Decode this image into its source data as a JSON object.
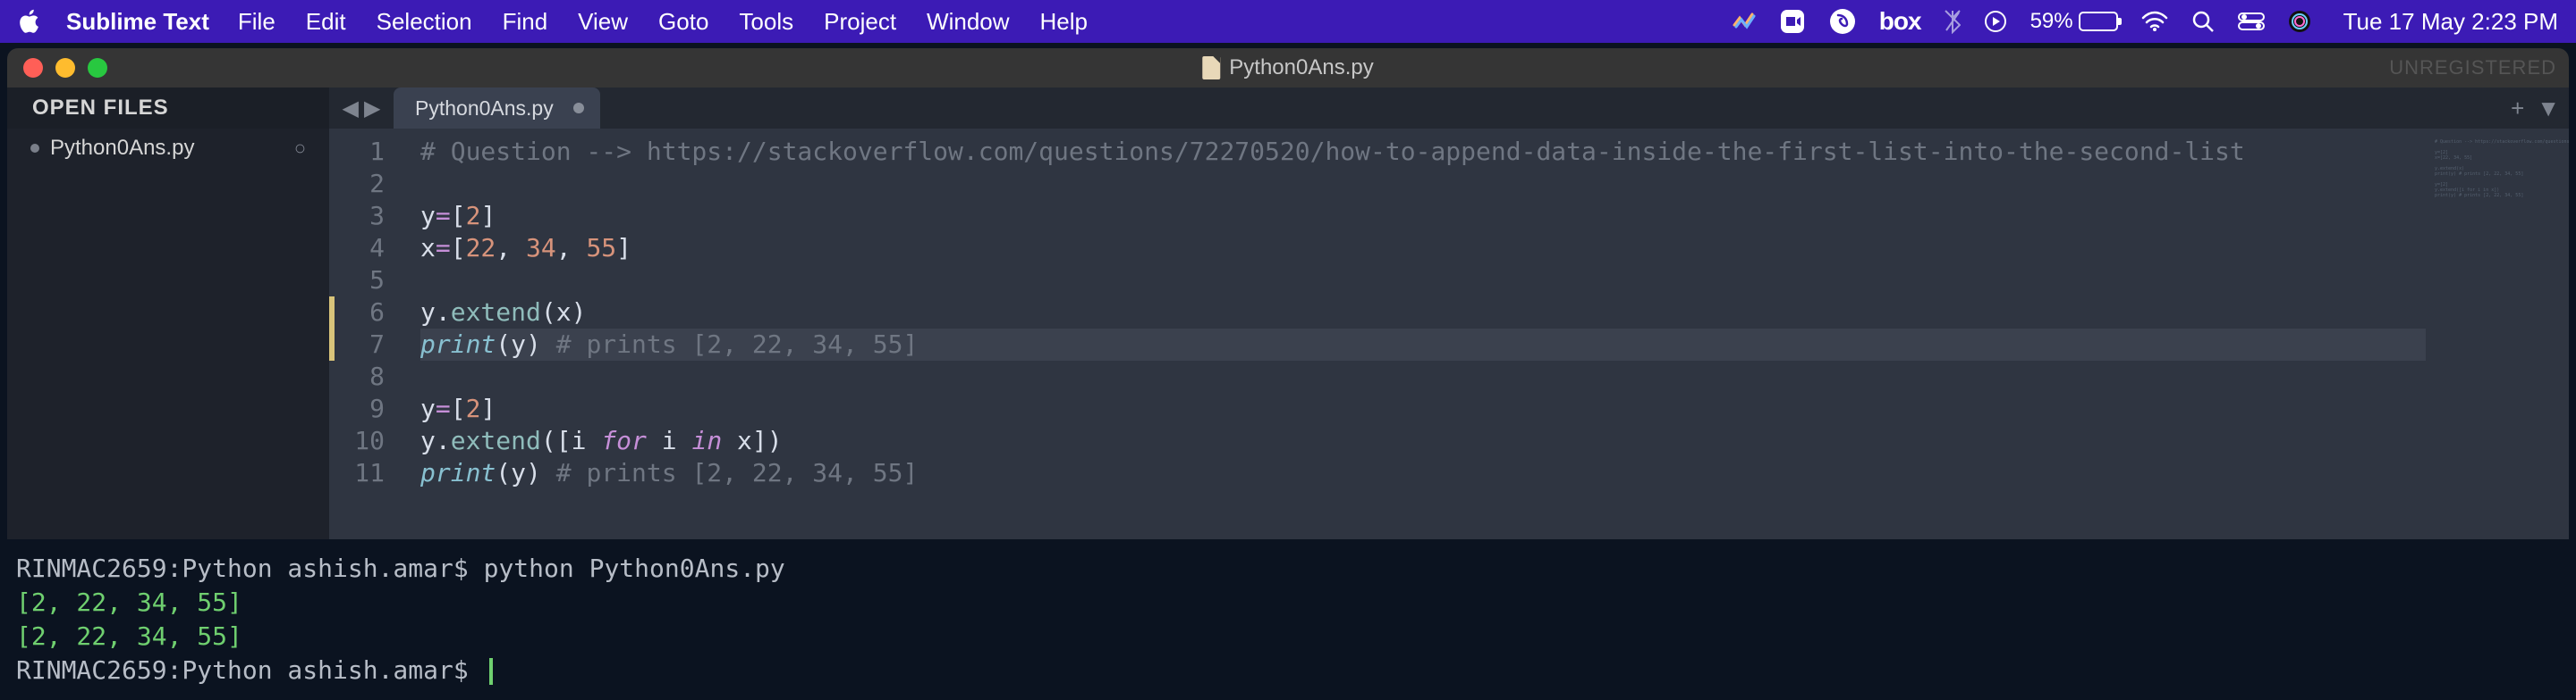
{
  "menubar": {
    "app_name": "Sublime Text",
    "items": [
      "File",
      "Edit",
      "Selection",
      "Find",
      "View",
      "Goto",
      "Tools",
      "Project",
      "Window",
      "Help"
    ],
    "battery_pct": "59%",
    "battery_fill_pct": 59,
    "datetime": "Tue 17 May  2:23 PM",
    "box_label": "box"
  },
  "window": {
    "title": "Python0Ans.py",
    "unregistered": "UNREGISTERED"
  },
  "sidebar": {
    "header": "OPEN FILES",
    "items": [
      {
        "label": "Python0Ans.py"
      }
    ]
  },
  "tabs": {
    "active_label": "Python0Ans.py"
  },
  "code": {
    "lines": [
      {
        "n": "1",
        "segs": [
          {
            "c": "cm-comment",
            "t": "# Question --> https://stackoverflow.com/questions/72270520/how-to-append-data-inside-the-first-list-into-the-second-list"
          }
        ]
      },
      {
        "n": "2",
        "segs": []
      },
      {
        "n": "3",
        "segs": [
          {
            "c": "cm-var",
            "t": "y"
          },
          {
            "c": "cm-op",
            "t": "="
          },
          {
            "c": "cm-punc",
            "t": "["
          },
          {
            "c": "cm-num",
            "t": "2"
          },
          {
            "c": "cm-punc",
            "t": "]"
          }
        ]
      },
      {
        "n": "4",
        "segs": [
          {
            "c": "cm-var",
            "t": "x"
          },
          {
            "c": "cm-op",
            "t": "="
          },
          {
            "c": "cm-punc",
            "t": "["
          },
          {
            "c": "cm-num",
            "t": "22"
          },
          {
            "c": "cm-punc",
            "t": ", "
          },
          {
            "c": "cm-num",
            "t": "34"
          },
          {
            "c": "cm-punc",
            "t": ", "
          },
          {
            "c": "cm-num",
            "t": "55"
          },
          {
            "c": "cm-punc",
            "t": "]"
          }
        ]
      },
      {
        "n": "5",
        "segs": []
      },
      {
        "n": "6",
        "modified": true,
        "segs": [
          {
            "c": "cm-var",
            "t": "y"
          },
          {
            "c": "cm-punc",
            "t": "."
          },
          {
            "c": "cm-method",
            "t": "extend"
          },
          {
            "c": "cm-punc",
            "t": "(x)"
          }
        ]
      },
      {
        "n": "7",
        "modified": true,
        "current": true,
        "segs": [
          {
            "c": "cm-builtin",
            "t": "print"
          },
          {
            "c": "cm-punc",
            "t": "(y) "
          },
          {
            "c": "cm-comment",
            "t": "# prints [2, 22, 34, 55]"
          }
        ]
      },
      {
        "n": "8",
        "segs": []
      },
      {
        "n": "9",
        "segs": [
          {
            "c": "cm-var",
            "t": "y"
          },
          {
            "c": "cm-op",
            "t": "="
          },
          {
            "c": "cm-punc",
            "t": "["
          },
          {
            "c": "cm-num",
            "t": "2"
          },
          {
            "c": "cm-punc",
            "t": "]"
          }
        ]
      },
      {
        "n": "10",
        "segs": [
          {
            "c": "cm-var",
            "t": "y"
          },
          {
            "c": "cm-punc",
            "t": "."
          },
          {
            "c": "cm-method",
            "t": "extend"
          },
          {
            "c": "cm-punc",
            "t": "([i "
          },
          {
            "c": "cm-kw",
            "t": "for"
          },
          {
            "c": "cm-punc",
            "t": " i "
          },
          {
            "c": "cm-kw",
            "t": "in"
          },
          {
            "c": "cm-punc",
            "t": " x])"
          }
        ]
      },
      {
        "n": "11",
        "segs": [
          {
            "c": "cm-builtin",
            "t": "print"
          },
          {
            "c": "cm-punc",
            "t": "(y) "
          },
          {
            "c": "cm-comment",
            "t": "# prints [2, 22, 34, 55]"
          }
        ]
      }
    ]
  },
  "terminal": {
    "prompt1_host": "RINMAC2659:Python ashish.amar$ ",
    "prompt1_cmd": "python Python0Ans.py",
    "out1": "[2, 22, 34, 55]",
    "out2": "[2, 22, 34, 55]",
    "prompt2_host": "RINMAC2659:Python ashish.amar$ "
  }
}
